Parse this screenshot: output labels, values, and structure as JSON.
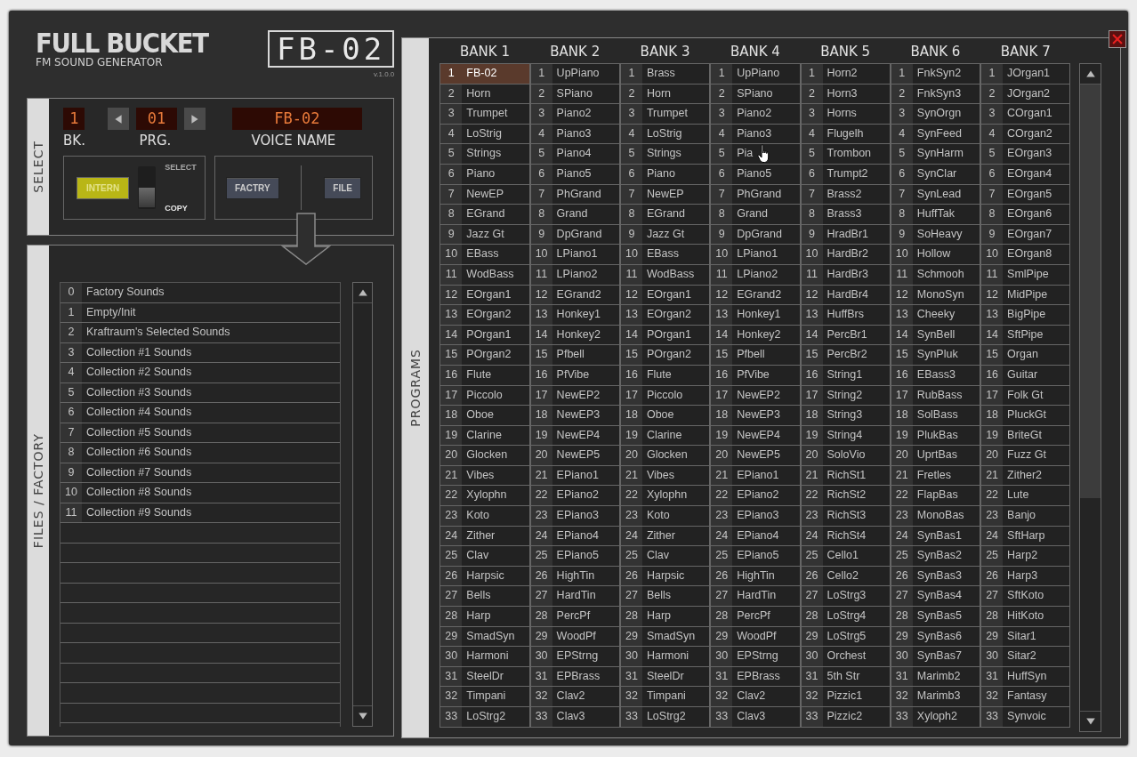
{
  "logo": {
    "brand": "FULL BUCKET",
    "subtitle": "FM SOUND GENERATOR",
    "model": "FB-02",
    "version": "v.1.0.0"
  },
  "select": {
    "label": "SELECT",
    "bank": {
      "value": "1",
      "label": "BK."
    },
    "program": {
      "value": "01",
      "label": "PRG."
    },
    "voice_name": {
      "value": "FB-02",
      "label": "VOICE NAME"
    },
    "intern_button": {
      "label": "INTERN",
      "on": true
    },
    "switch": {
      "options": [
        {
          "label": "SELECT",
          "selected": false
        },
        {
          "label": "COPY",
          "selected": true
        }
      ]
    },
    "buttons": [
      {
        "label": "FACTRY"
      },
      {
        "label": "FILE"
      }
    ]
  },
  "files": {
    "label": "FILES / FACTORY",
    "items": [
      {
        "n": "0",
        "name": "Factory Sounds",
        "selected": false
      },
      {
        "n": "1",
        "name": "Empty/Init",
        "selected": false
      },
      {
        "n": "2",
        "name": "Kraftraum's Selected Sounds",
        "selected": false
      },
      {
        "n": "3",
        "name": "Collection #1 Sounds",
        "selected": false
      },
      {
        "n": "4",
        "name": "Collection #2 Sounds",
        "selected": false
      },
      {
        "n": "5",
        "name": "Collection #3 Sounds",
        "selected": false
      },
      {
        "n": "6",
        "name": "Collection #4 Sounds",
        "selected": false
      },
      {
        "n": "7",
        "name": "Collection #5 Sounds",
        "selected": false
      },
      {
        "n": "8",
        "name": "Collection #6 Sounds",
        "selected": false
      },
      {
        "n": "9",
        "name": "Collection #7 Sounds",
        "selected": false
      },
      {
        "n": "10",
        "name": "Collection #8 Sounds",
        "selected": false
      },
      {
        "n": "11",
        "name": "Collection #9 Sounds",
        "selected": false
      }
    ]
  },
  "programs": {
    "label": "PROGRAMS",
    "banks": [
      {
        "name": "BANK 1",
        "programs": [
          {
            "n": "1",
            "name": "FB-02",
            "selected": true
          },
          {
            "n": "2",
            "name": "Horn",
            "selected": false
          },
          {
            "n": "3",
            "name": "Trumpet",
            "selected": false
          },
          {
            "n": "4",
            "name": "LoStrig",
            "selected": false
          },
          {
            "n": "5",
            "name": "Strings",
            "selected": false
          },
          {
            "n": "6",
            "name": "Piano",
            "selected": false
          },
          {
            "n": "7",
            "name": "NewEP",
            "selected": false
          },
          {
            "n": "8",
            "name": "EGrand",
            "selected": false
          },
          {
            "n": "9",
            "name": "Jazz Gt",
            "selected": false
          },
          {
            "n": "10",
            "name": "EBass",
            "selected": false
          },
          {
            "n": "11",
            "name": "WodBass",
            "selected": false
          },
          {
            "n": "12",
            "name": "EOrgan1",
            "selected": false
          },
          {
            "n": "13",
            "name": "EOrgan2",
            "selected": false
          },
          {
            "n": "14",
            "name": "POrgan1",
            "selected": false
          },
          {
            "n": "15",
            "name": "POrgan2",
            "selected": false
          },
          {
            "n": "16",
            "name": "Flute",
            "selected": false
          },
          {
            "n": "17",
            "name": "Piccolo",
            "selected": false
          },
          {
            "n": "18",
            "name": "Oboe",
            "selected": false
          },
          {
            "n": "19",
            "name": "Clarine",
            "selected": false
          },
          {
            "n": "20",
            "name": "Glocken",
            "selected": false
          },
          {
            "n": "21",
            "name": "Vibes",
            "selected": false
          },
          {
            "n": "22",
            "name": "Xylophn",
            "selected": false
          },
          {
            "n": "23",
            "name": "Koto",
            "selected": false
          },
          {
            "n": "24",
            "name": "Zither",
            "selected": false
          },
          {
            "n": "25",
            "name": "Clav",
            "selected": false
          },
          {
            "n": "26",
            "name": "Harpsic",
            "selected": false
          },
          {
            "n": "27",
            "name": "Bells",
            "selected": false
          },
          {
            "n": "28",
            "name": "Harp",
            "selected": false
          },
          {
            "n": "29",
            "name": "SmadSyn",
            "selected": false
          },
          {
            "n": "30",
            "name": "Harmoni",
            "selected": false
          },
          {
            "n": "31",
            "name": "SteelDr",
            "selected": false
          },
          {
            "n": "32",
            "name": "Timpani",
            "selected": false
          },
          {
            "n": "33",
            "name": "LoStrg2",
            "selected": false
          }
        ]
      },
      {
        "name": "BANK 2",
        "programs": [
          {
            "n": "1",
            "name": "UpPiano",
            "selected": false
          },
          {
            "n": "2",
            "name": "SPiano",
            "selected": false
          },
          {
            "n": "3",
            "name": "Piano2",
            "selected": false
          },
          {
            "n": "4",
            "name": "Piano3",
            "selected": false
          },
          {
            "n": "5",
            "name": "Piano4",
            "selected": false
          },
          {
            "n": "6",
            "name": "Piano5",
            "selected": false
          },
          {
            "n": "7",
            "name": "PhGrand",
            "selected": false
          },
          {
            "n": "8",
            "name": "Grand",
            "selected": false
          },
          {
            "n": "9",
            "name": "DpGrand",
            "selected": false
          },
          {
            "n": "10",
            "name": "LPiano1",
            "selected": false
          },
          {
            "n": "11",
            "name": "LPiano2",
            "selected": false
          },
          {
            "n": "12",
            "name": "EGrand2",
            "selected": false
          },
          {
            "n": "13",
            "name": "Honkey1",
            "selected": false
          },
          {
            "n": "14",
            "name": "Honkey2",
            "selected": false
          },
          {
            "n": "15",
            "name": "Pfbell",
            "selected": false
          },
          {
            "n": "16",
            "name": "PfVibe",
            "selected": false
          },
          {
            "n": "17",
            "name": "NewEP2",
            "selected": false
          },
          {
            "n": "18",
            "name": "NewEP3",
            "selected": false
          },
          {
            "n": "19",
            "name": "NewEP4",
            "selected": false
          },
          {
            "n": "20",
            "name": "NewEP5",
            "selected": false
          },
          {
            "n": "21",
            "name": "EPiano1",
            "selected": false
          },
          {
            "n": "22",
            "name": "EPiano2",
            "selected": false
          },
          {
            "n": "23",
            "name": "EPiano3",
            "selected": false
          },
          {
            "n": "24",
            "name": "EPiano4",
            "selected": false
          },
          {
            "n": "25",
            "name": "EPiano5",
            "selected": false
          },
          {
            "n": "26",
            "name": "HighTin",
            "selected": false
          },
          {
            "n": "27",
            "name": "HardTin",
            "selected": false
          },
          {
            "n": "28",
            "name": "PercPf",
            "selected": false
          },
          {
            "n": "29",
            "name": "WoodPf",
            "selected": false
          },
          {
            "n": "30",
            "name": "EPStrng",
            "selected": false
          },
          {
            "n": "31",
            "name": "EPBrass",
            "selected": false
          },
          {
            "n": "32",
            "name": "Clav2",
            "selected": false
          },
          {
            "n": "33",
            "name": "Clav3",
            "selected": false
          }
        ]
      },
      {
        "name": "BANK 3",
        "programs": [
          {
            "n": "1",
            "name": "Brass",
            "selected": false
          },
          {
            "n": "2",
            "name": "Horn",
            "selected": false
          },
          {
            "n": "3",
            "name": "Trumpet",
            "selected": false
          },
          {
            "n": "4",
            "name": "LoStrig",
            "selected": false
          },
          {
            "n": "5",
            "name": "Strings",
            "selected": false
          },
          {
            "n": "6",
            "name": "Piano",
            "selected": false
          },
          {
            "n": "7",
            "name": "NewEP",
            "selected": false
          },
          {
            "n": "8",
            "name": "EGrand",
            "selected": false
          },
          {
            "n": "9",
            "name": "Jazz Gt",
            "selected": false
          },
          {
            "n": "10",
            "name": "EBass",
            "selected": false
          },
          {
            "n": "11",
            "name": "WodBass",
            "selected": false
          },
          {
            "n": "12",
            "name": "EOrgan1",
            "selected": false
          },
          {
            "n": "13",
            "name": "EOrgan2",
            "selected": false
          },
          {
            "n": "14",
            "name": "POrgan1",
            "selected": false
          },
          {
            "n": "15",
            "name": "POrgan2",
            "selected": false
          },
          {
            "n": "16",
            "name": "Flute",
            "selected": false
          },
          {
            "n": "17",
            "name": "Piccolo",
            "selected": false
          },
          {
            "n": "18",
            "name": "Oboe",
            "selected": false
          },
          {
            "n": "19",
            "name": "Clarine",
            "selected": false
          },
          {
            "n": "20",
            "name": "Glocken",
            "selected": false
          },
          {
            "n": "21",
            "name": "Vibes",
            "selected": false
          },
          {
            "n": "22",
            "name": "Xylophn",
            "selected": false
          },
          {
            "n": "23",
            "name": "Koto",
            "selected": false
          },
          {
            "n": "24",
            "name": "Zither",
            "selected": false
          },
          {
            "n": "25",
            "name": "Clav",
            "selected": false
          },
          {
            "n": "26",
            "name": "Harpsic",
            "selected": false
          },
          {
            "n": "27",
            "name": "Bells",
            "selected": false
          },
          {
            "n": "28",
            "name": "Harp",
            "selected": false
          },
          {
            "n": "29",
            "name": "SmadSyn",
            "selected": false
          },
          {
            "n": "30",
            "name": "Harmoni",
            "selected": false
          },
          {
            "n": "31",
            "name": "SteelDr",
            "selected": false
          },
          {
            "n": "32",
            "name": "Timpani",
            "selected": false
          },
          {
            "n": "33",
            "name": "LoStrg2",
            "selected": false
          }
        ]
      },
      {
        "name": "BANK 4",
        "programs": [
          {
            "n": "1",
            "name": "UpPiano",
            "selected": false
          },
          {
            "n": "2",
            "name": "SPiano",
            "selected": false
          },
          {
            "n": "3",
            "name": "Piano2",
            "selected": false
          },
          {
            "n": "4",
            "name": "Piano3",
            "selected": false
          },
          {
            "n": "5",
            "name": "Pia",
            "selected": false
          },
          {
            "n": "6",
            "name": "Piano5",
            "selected": false
          },
          {
            "n": "7",
            "name": "PhGrand",
            "selected": false
          },
          {
            "n": "8",
            "name": "Grand",
            "selected": false
          },
          {
            "n": "9",
            "name": "DpGrand",
            "selected": false
          },
          {
            "n": "10",
            "name": "LPiano1",
            "selected": false
          },
          {
            "n": "11",
            "name": "LPiano2",
            "selected": false
          },
          {
            "n": "12",
            "name": "EGrand2",
            "selected": false
          },
          {
            "n": "13",
            "name": "Honkey1",
            "selected": false
          },
          {
            "n": "14",
            "name": "Honkey2",
            "selected": false
          },
          {
            "n": "15",
            "name": "Pfbell",
            "selected": false
          },
          {
            "n": "16",
            "name": "PfVibe",
            "selected": false
          },
          {
            "n": "17",
            "name": "NewEP2",
            "selected": false
          },
          {
            "n": "18",
            "name": "NewEP3",
            "selected": false
          },
          {
            "n": "19",
            "name": "NewEP4",
            "selected": false
          },
          {
            "n": "20",
            "name": "NewEP5",
            "selected": false
          },
          {
            "n": "21",
            "name": "EPiano1",
            "selected": false
          },
          {
            "n": "22",
            "name": "EPiano2",
            "selected": false
          },
          {
            "n": "23",
            "name": "EPiano3",
            "selected": false
          },
          {
            "n": "24",
            "name": "EPiano4",
            "selected": false
          },
          {
            "n": "25",
            "name": "EPiano5",
            "selected": false
          },
          {
            "n": "26",
            "name": "HighTin",
            "selected": false
          },
          {
            "n": "27",
            "name": "HardTin",
            "selected": false
          },
          {
            "n": "28",
            "name": "PercPf",
            "selected": false
          },
          {
            "n": "29",
            "name": "WoodPf",
            "selected": false
          },
          {
            "n": "30",
            "name": "EPStrng",
            "selected": false
          },
          {
            "n": "31",
            "name": "EPBrass",
            "selected": false
          },
          {
            "n": "32",
            "name": "Clav2",
            "selected": false
          },
          {
            "n": "33",
            "name": "Clav3",
            "selected": false
          }
        ]
      },
      {
        "name": "BANK 5",
        "programs": [
          {
            "n": "1",
            "name": "Horn2",
            "selected": false
          },
          {
            "n": "2",
            "name": "Horn3",
            "selected": false
          },
          {
            "n": "3",
            "name": "Horns",
            "selected": false
          },
          {
            "n": "4",
            "name": "Flugelh",
            "selected": false
          },
          {
            "n": "5",
            "name": "Trombon",
            "selected": false
          },
          {
            "n": "6",
            "name": "Trumpt2",
            "selected": false
          },
          {
            "n": "7",
            "name": "Brass2",
            "selected": false
          },
          {
            "n": "8",
            "name": "Brass3",
            "selected": false
          },
          {
            "n": "9",
            "name": "HradBr1",
            "selected": false
          },
          {
            "n": "10",
            "name": "HardBr2",
            "selected": false
          },
          {
            "n": "11",
            "name": "HardBr3",
            "selected": false
          },
          {
            "n": "12",
            "name": "HardBr4",
            "selected": false
          },
          {
            "n": "13",
            "name": "HuffBrs",
            "selected": false
          },
          {
            "n": "14",
            "name": "PercBr1",
            "selected": false
          },
          {
            "n": "15",
            "name": "PercBr2",
            "selected": false
          },
          {
            "n": "16",
            "name": "String1",
            "selected": false
          },
          {
            "n": "17",
            "name": "String2",
            "selected": false
          },
          {
            "n": "18",
            "name": "String3",
            "selected": false
          },
          {
            "n": "19",
            "name": "String4",
            "selected": false
          },
          {
            "n": "20",
            "name": "SoloVio",
            "selected": false
          },
          {
            "n": "21",
            "name": "RichSt1",
            "selected": false
          },
          {
            "n": "22",
            "name": "RichSt2",
            "selected": false
          },
          {
            "n": "23",
            "name": "RichSt3",
            "selected": false
          },
          {
            "n": "24",
            "name": "RichSt4",
            "selected": false
          },
          {
            "n": "25",
            "name": "Cello1",
            "selected": false
          },
          {
            "n": "26",
            "name": "Cello2",
            "selected": false
          },
          {
            "n": "27",
            "name": "LoStrg3",
            "selected": false
          },
          {
            "n": "28",
            "name": "LoStrg4",
            "selected": false
          },
          {
            "n": "29",
            "name": "LoStrg5",
            "selected": false
          },
          {
            "n": "30",
            "name": "Orchest",
            "selected": false
          },
          {
            "n": "31",
            "name": "5th Str",
            "selected": false
          },
          {
            "n": "32",
            "name": "Pizzic1",
            "selected": false
          },
          {
            "n": "33",
            "name": "Pizzic2",
            "selected": false
          }
        ]
      },
      {
        "name": "BANK 6",
        "programs": [
          {
            "n": "1",
            "name": "FnkSyn2",
            "selected": false
          },
          {
            "n": "2",
            "name": "FnkSyn3",
            "selected": false
          },
          {
            "n": "3",
            "name": "SynOrgn",
            "selected": false
          },
          {
            "n": "4",
            "name": "SynFeed",
            "selected": false
          },
          {
            "n": "5",
            "name": "SynHarm",
            "selected": false
          },
          {
            "n": "6",
            "name": "SynClar",
            "selected": false
          },
          {
            "n": "7",
            "name": "SynLead",
            "selected": false
          },
          {
            "n": "8",
            "name": "HuffTak",
            "selected": false
          },
          {
            "n": "9",
            "name": "SoHeavy",
            "selected": false
          },
          {
            "n": "10",
            "name": "Hollow",
            "selected": false
          },
          {
            "n": "11",
            "name": "Schmooh",
            "selected": false
          },
          {
            "n": "12",
            "name": "MonoSyn",
            "selected": false
          },
          {
            "n": "13",
            "name": "Cheeky",
            "selected": false
          },
          {
            "n": "14",
            "name": "SynBell",
            "selected": false
          },
          {
            "n": "15",
            "name": "SynPluk",
            "selected": false
          },
          {
            "n": "16",
            "name": "EBass3",
            "selected": false
          },
          {
            "n": "17",
            "name": "RubBass",
            "selected": false
          },
          {
            "n": "18",
            "name": "SolBass",
            "selected": false
          },
          {
            "n": "19",
            "name": "PlukBas",
            "selected": false
          },
          {
            "n": "20",
            "name": "UprtBas",
            "selected": false
          },
          {
            "n": "21",
            "name": "Fretles",
            "selected": false
          },
          {
            "n": "22",
            "name": "FlapBas",
            "selected": false
          },
          {
            "n": "23",
            "name": "MonoBas",
            "selected": false
          },
          {
            "n": "24",
            "name": "SynBas1",
            "selected": false
          },
          {
            "n": "25",
            "name": "SynBas2",
            "selected": false
          },
          {
            "n": "26",
            "name": "SynBas3",
            "selected": false
          },
          {
            "n": "27",
            "name": "SynBas4",
            "selected": false
          },
          {
            "n": "28",
            "name": "SynBas5",
            "selected": false
          },
          {
            "n": "29",
            "name": "SynBas6",
            "selected": false
          },
          {
            "n": "30",
            "name": "SynBas7",
            "selected": false
          },
          {
            "n": "31",
            "name": "Marimb2",
            "selected": false
          },
          {
            "n": "32",
            "name": "Marimb3",
            "selected": false
          },
          {
            "n": "33",
            "name": "Xyloph2",
            "selected": false
          }
        ]
      },
      {
        "name": "BANK 7",
        "programs": [
          {
            "n": "1",
            "name": "JOrgan1",
            "selected": false
          },
          {
            "n": "2",
            "name": "JOrgan2",
            "selected": false
          },
          {
            "n": "3",
            "name": "COrgan1",
            "selected": false
          },
          {
            "n": "4",
            "name": "COrgan2",
            "selected": false
          },
          {
            "n": "5",
            "name": "EOrgan3",
            "selected": false
          },
          {
            "n": "6",
            "name": "EOrgan4",
            "selected": false
          },
          {
            "n": "7",
            "name": "EOrgan5",
            "selected": false
          },
          {
            "n": "8",
            "name": "EOrgan6",
            "selected": false
          },
          {
            "n": "9",
            "name": "EOrgan7",
            "selected": false
          },
          {
            "n": "10",
            "name": "EOrgan8",
            "selected": false
          },
          {
            "n": "11",
            "name": "SmlPipe",
            "selected": false
          },
          {
            "n": "12",
            "name": "MidPipe",
            "selected": false
          },
          {
            "n": "13",
            "name": "BigPipe",
            "selected": false
          },
          {
            "n": "14",
            "name": "SftPipe",
            "selected": false
          },
          {
            "n": "15",
            "name": "Organ",
            "selected": false
          },
          {
            "n": "16",
            "name": "Guitar",
            "selected": false
          },
          {
            "n": "17",
            "name": "Folk Gt",
            "selected": false
          },
          {
            "n": "18",
            "name": "PluckGt",
            "selected": false
          },
          {
            "n": "19",
            "name": "BriteGt",
            "selected": false
          },
          {
            "n": "20",
            "name": "Fuzz Gt",
            "selected": false
          },
          {
            "n": "21",
            "name": "Zither2",
            "selected": false
          },
          {
            "n": "22",
            "name": "Lute",
            "selected": false
          },
          {
            "n": "23",
            "name": "Banjo",
            "selected": false
          },
          {
            "n": "24",
            "name": "SftHarp",
            "selected": false
          },
          {
            "n": "25",
            "name": "Harp2",
            "selected": false
          },
          {
            "n": "26",
            "name": "Harp3",
            "selected": false
          },
          {
            "n": "27",
            "name": "SftKoto",
            "selected": false
          },
          {
            "n": "28",
            "name": "HitKoto",
            "selected": false
          },
          {
            "n": "29",
            "name": "Sitar1",
            "selected": false
          },
          {
            "n": "30",
            "name": "Sitar2",
            "selected": false
          },
          {
            "n": "31",
            "name": "HuffSyn",
            "selected": false
          },
          {
            "n": "32",
            "name": "Fantasy",
            "selected": false
          },
          {
            "n": "33",
            "name": "Synvoic",
            "selected": false
          }
        ]
      }
    ]
  }
}
